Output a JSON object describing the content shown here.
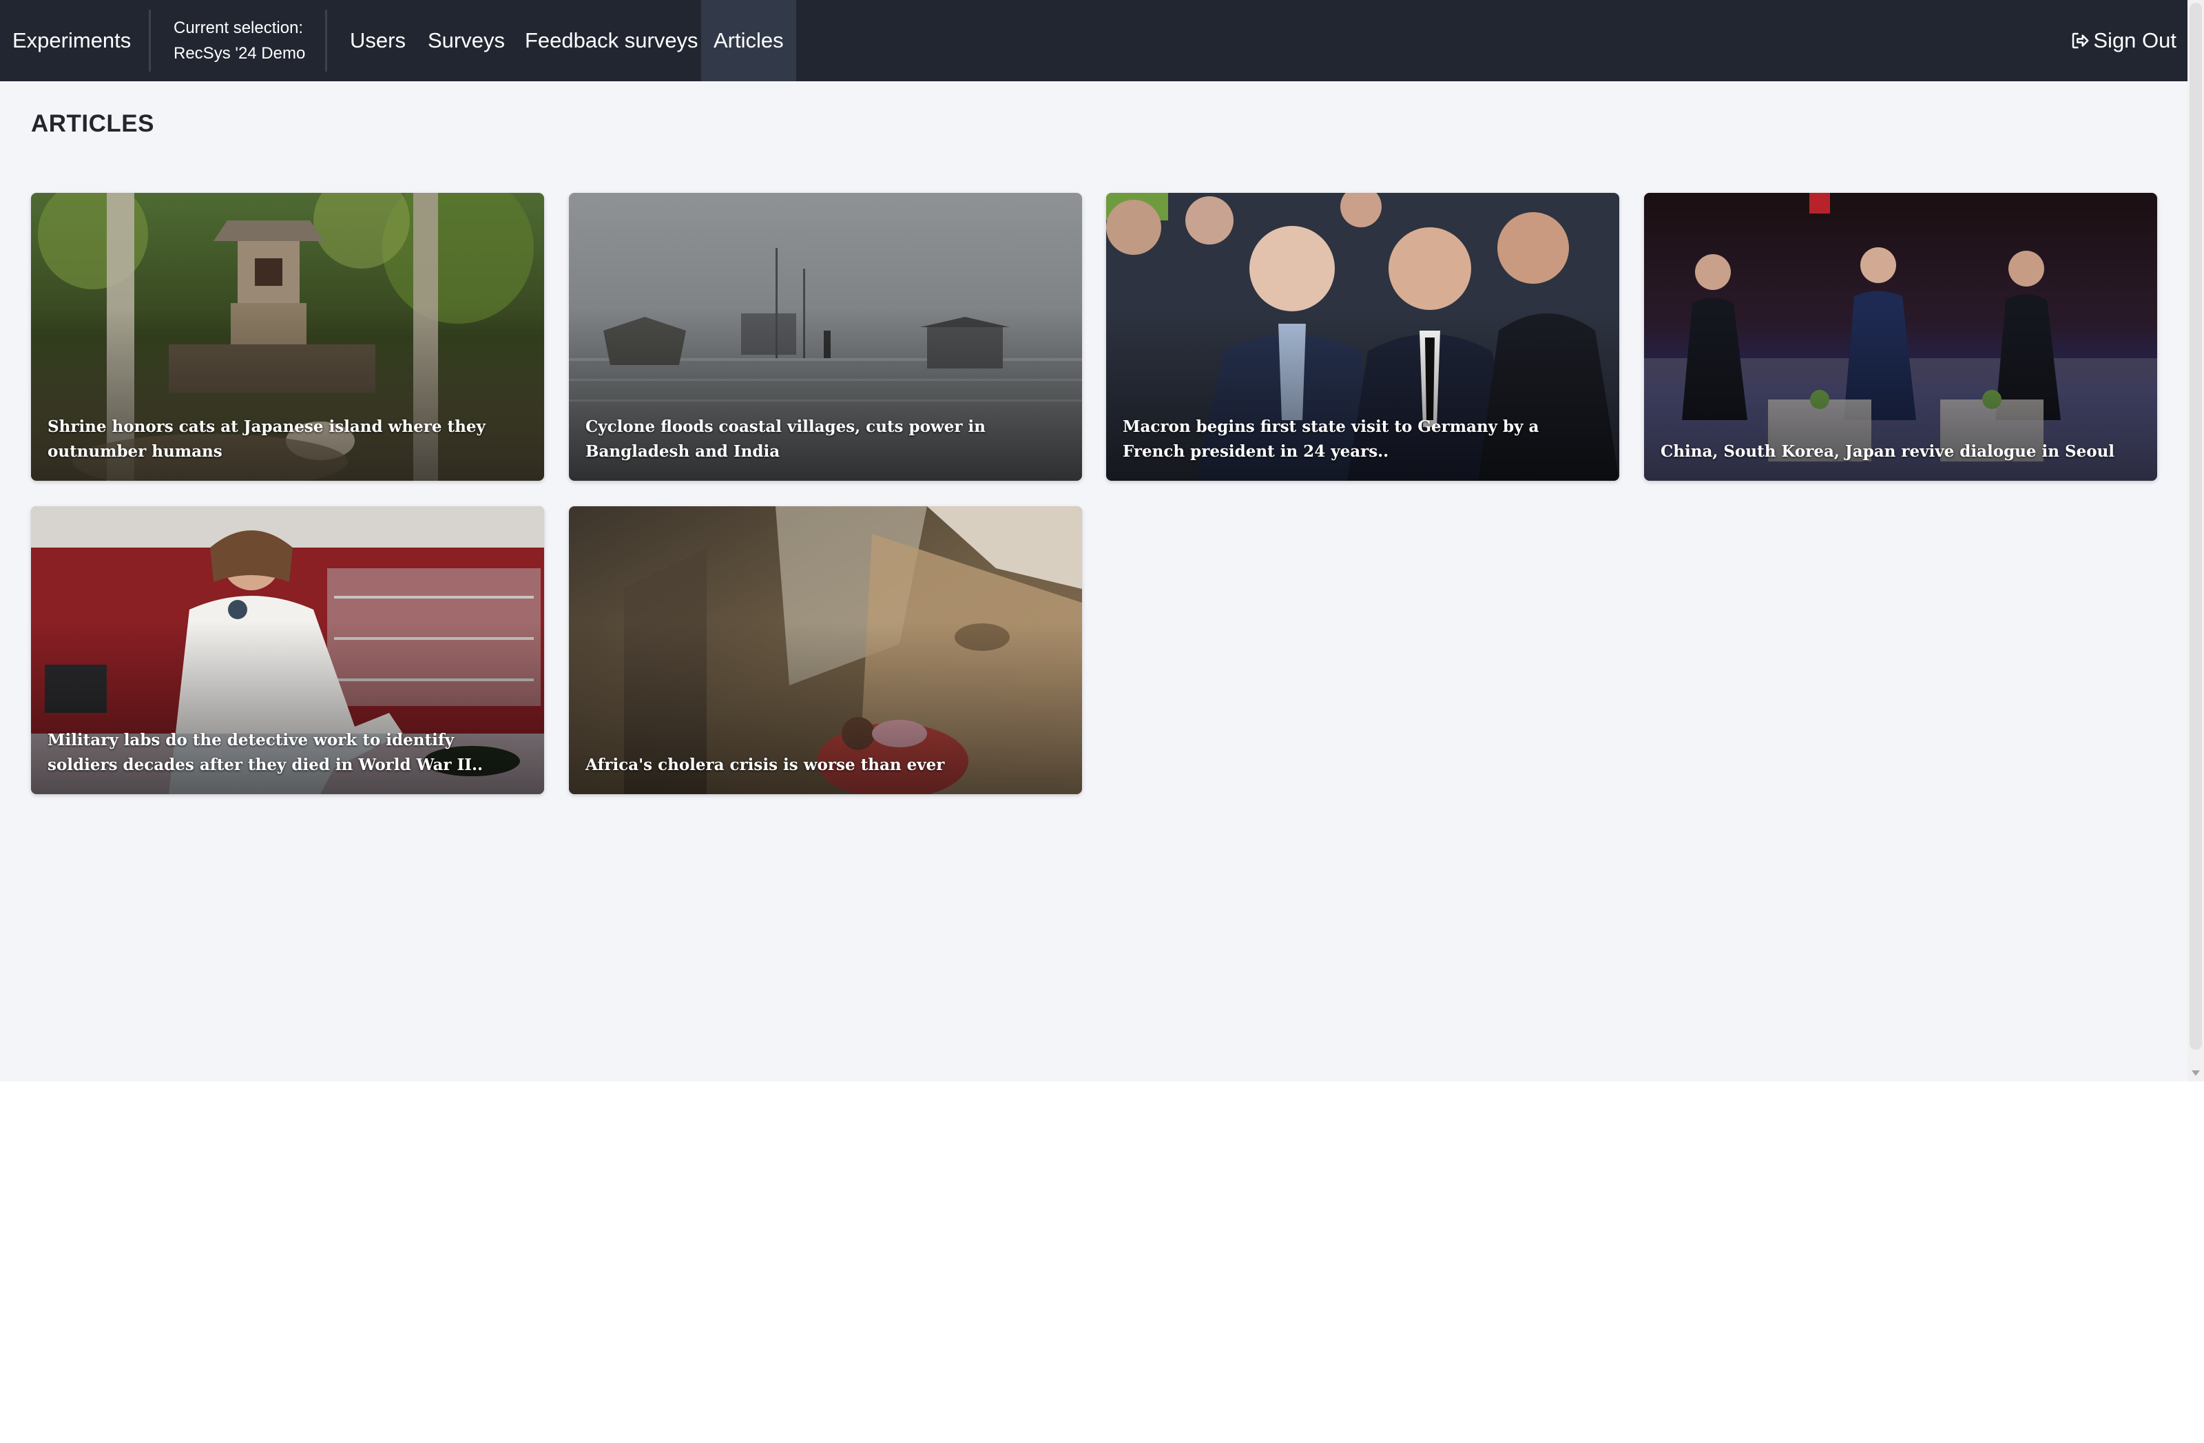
{
  "navbar": {
    "brand": "Experiments",
    "selection_label": "Current selection:",
    "selection_value": "RecSys '24 Demo",
    "links": [
      "Users",
      "Surveys",
      "Feedback surveys",
      "Articles"
    ],
    "active_link": "Articles",
    "signout_label": "Sign Out",
    "signout_icon": "sign-out-icon"
  },
  "page": {
    "title": "ARTICLES"
  },
  "articles": [
    {
      "title": "Shrine honors cats at Japanese island where they outnumber humans"
    },
    {
      "title": "Cyclone floods coastal villages, cuts power in Bangladesh and India"
    },
    {
      "title": "Macron begins first state visit to Germany by a French president in 24 years.."
    },
    {
      "title": "China, South Korea, Japan revive dialogue in Seoul"
    },
    {
      "title": "Military labs do the detective work to identify soldiers decades after they died in World War II.."
    },
    {
      "title": "Africa's cholera crisis is worse than ever"
    }
  ],
  "colors": {
    "navbar_bg": "#212631",
    "navbar_active_bg": "#323a49",
    "page_bg": "#f4f5f9"
  }
}
